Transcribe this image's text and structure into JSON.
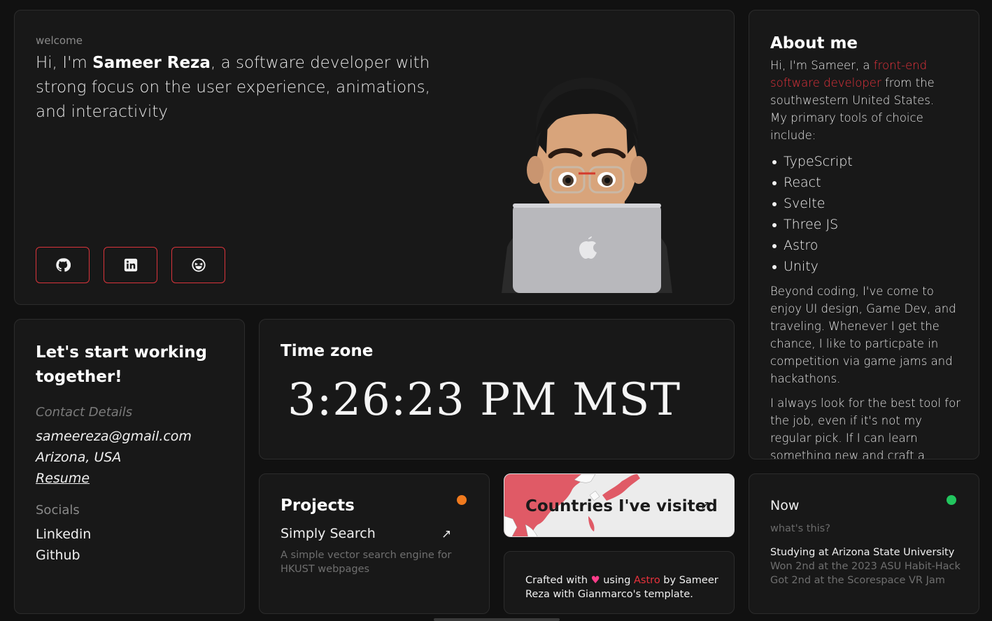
{
  "hero": {
    "eyebrow": "welcome",
    "greeting_pre": "Hi, I'm ",
    "name": "Sameer Reza",
    "greeting_post": ", a software developer with strong focus on the user experience, animations, and interactivity",
    "social_buttons": [
      {
        "icon": "github-icon"
      },
      {
        "icon": "linkedin-icon"
      },
      {
        "icon": "smiley-icon"
      }
    ],
    "accent_color": "#d9343b"
  },
  "about": {
    "title": "About me",
    "intro_pre": "Hi, I'm Sameer, a ",
    "intro_link": "front-end software developer",
    "intro_post": " from the southwestern United States.",
    "tools_intro": "My primary tools of choice include:",
    "tools": [
      "TypeScript",
      "React",
      "Svelte",
      "Three JS",
      "Astro",
      "Unity"
    ],
    "para1": "Beyond coding, I've come to enjoy UI design, Game Dev, and traveling. Whenever I get the chance, I like to particpate in competition via game jams and hackathons.",
    "para2": "I always look for the best tool for the job, even if it's not my regular pick. If I can learn something new and craft a better interactive experience, I'm all for it."
  },
  "contact": {
    "title": "Let's start working together!",
    "details_label": "Contact Details",
    "email": "sameereza@gmail.com",
    "location": "Arizona, USA",
    "resume": "Resume",
    "socials_label": "Socials",
    "socials": [
      "Linkedin",
      "Github"
    ]
  },
  "timezone": {
    "title": "Time zone",
    "clock": "3:26:23 PM MST"
  },
  "projects": {
    "title": "Projects",
    "status_color": "#f07a1e",
    "name": "Simply Search",
    "arrow": "↗",
    "description": "A simple vector search engine for HKUST webpages"
  },
  "countries": {
    "title": "Countries I've visited",
    "arrow": "↗",
    "map_color": "#e05a66"
  },
  "crafted": {
    "pre": "Crafted with ",
    "heart": "♥",
    "mid": " using ",
    "link": "Astro",
    "post": " by Sameer Reza with Gianmarco's template."
  },
  "now": {
    "title": "Now",
    "status_color": "#22c55e",
    "subtitle": "what's this?",
    "line1": "Studying at Arizona State University",
    "line2": "Won 2nd at the 2023 ASU Habit-Hack",
    "line3": "Got 2nd at the Scorespace VR Jam"
  }
}
